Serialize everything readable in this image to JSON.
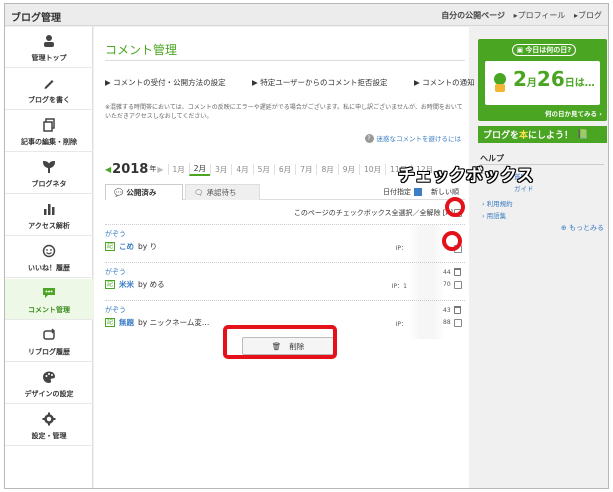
{
  "topbar": {
    "title": "ブログ管理",
    "nav": [
      "自分の公開ページ",
      "▸プロフィール",
      "▸ブログ"
    ]
  },
  "sidebar": {
    "items": [
      {
        "label": "管理トップ",
        "icon": "person-icon"
      },
      {
        "label": "ブログを書く",
        "icon": "pencil-icon"
      },
      {
        "label": "記事の編集・削除",
        "icon": "documents-icon"
      },
      {
        "label": "ブログネタ",
        "icon": "sprout-icon"
      },
      {
        "label": "アクセス解析",
        "icon": "bar-chart-icon"
      },
      {
        "label": "いいね！履歴",
        "icon": "smiley-icon"
      },
      {
        "label": "コメント管理",
        "icon": "comment-icon"
      },
      {
        "label": "リブログ履歴",
        "icon": "reblog-icon"
      },
      {
        "label": "デザインの設定",
        "icon": "palette-icon"
      },
      {
        "label": "設定・管理",
        "icon": "gear-icon"
      }
    ],
    "active": "コメント管理"
  },
  "main": {
    "title": "コメント管理",
    "links": [
      "コメントの受付・公開方法の設定",
      "特定ユーザーからのコメント拒否設定",
      "コメントの通知設定"
    ],
    "notice": "※混雑する時間帯においては、コメントの反映にエラーや遅延がでる場合がございます。私に申し訳ございませんが、お時間をおいていただきアクセスしなおしてください。",
    "spam_link": "迷惑なコメントを避けるには",
    "year": "2018",
    "year_suffix": "年",
    "months": [
      "1月",
      "2月",
      "3月",
      "4月",
      "5月",
      "6月",
      "7月",
      "8月",
      "9月",
      "10月",
      "11月",
      "12月"
    ],
    "selected_month": "2月",
    "tabs": {
      "published": "公開済み",
      "pending": "承認待ち"
    },
    "date_option": "日付指定",
    "sort_label": "新しい順",
    "select_all": "このページのチェックボックス全選択／全解除 [A]",
    "comments": [
      {
        "author": "がぞう",
        "tag": "記",
        "title": "こめ",
        "by": "by り",
        "ip_label": "IP："
      },
      {
        "author": "がぞう",
        "tag": "記",
        "title": "米米",
        "by": "by める",
        "ip_label": "IP：1",
        "frag1": "44",
        "frag2": "70"
      },
      {
        "author": "がぞう",
        "tag": "記",
        "title": "無題",
        "by": "by ニックネーム変…",
        "ip_label": "IP：",
        "frag1": "43",
        "frag2": "88"
      }
    ],
    "delete_button": "削除"
  },
  "annotation": {
    "callout": "チェックボックス",
    "color": "#e4111b"
  },
  "right_panel": {
    "banner_pill": "今日は何の日?",
    "banner_date_month": "2",
    "banner_date_month_unit": "月",
    "banner_date_day": "26",
    "banner_date_suffix": "日は…",
    "banner_more": "何の日か見てみる ›",
    "book_banner_pre": "ブログを",
    "book_banner_hl": "本",
    "book_banner_post": "にしよう！",
    "help_heading": "ヘルプ",
    "help_links": [
      "質問",
      "ガイド",
      "利用規約",
      "用語集"
    ],
    "more_link": "もっとみる"
  },
  "colors": {
    "accent": "#49a522",
    "link": "#3c7dc4",
    "annotation": "#e4111b"
  }
}
